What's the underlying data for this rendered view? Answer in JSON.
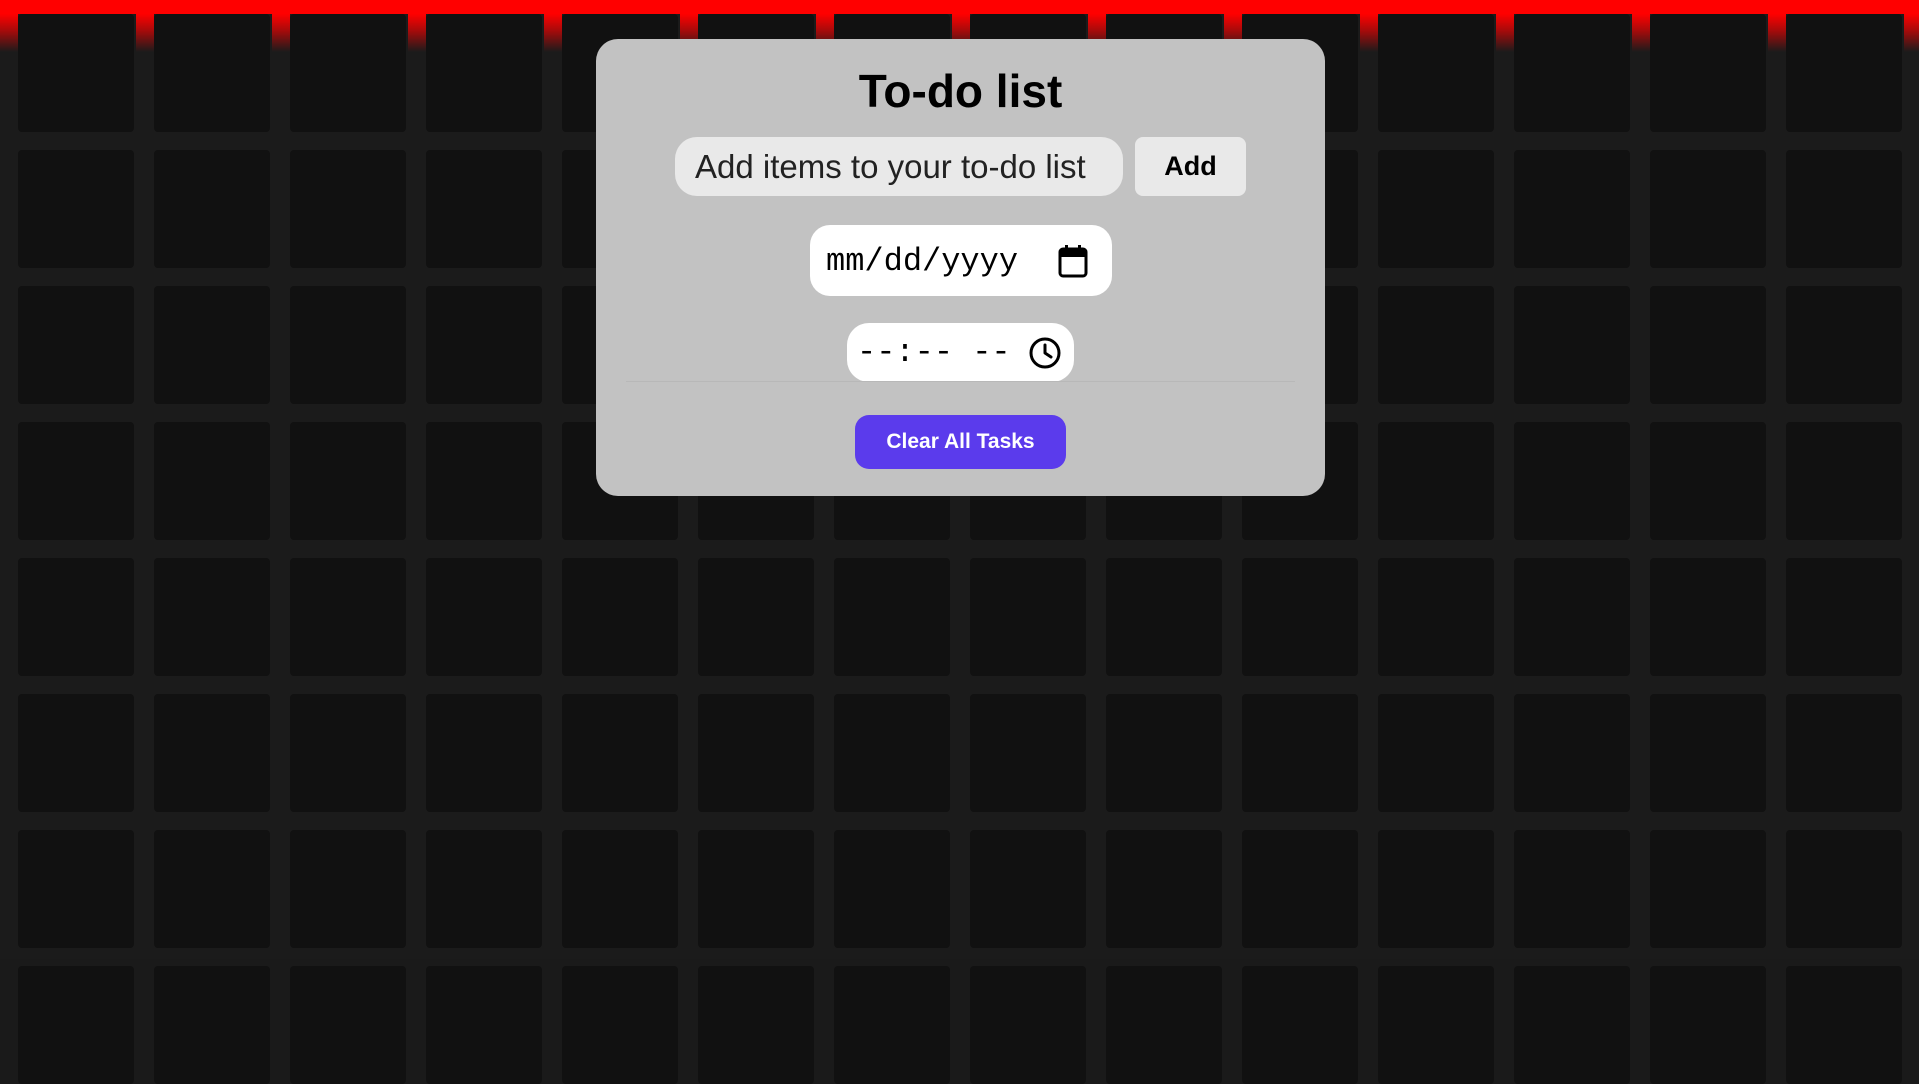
{
  "colors": {
    "background": "#1b1b1b",
    "cell": "#111111",
    "top_bar": "#ff0000",
    "panel": "#c2c2c2",
    "input_bg": "#e9e9e9",
    "accent_button": "#5b3bec"
  },
  "app": {
    "title": "To-do list"
  },
  "task_form": {
    "placeholder": "Add items to your to-do list",
    "add_label": "Add"
  },
  "date_field": {
    "placeholder": "mm/dd/yyyy",
    "icon": "calendar-icon"
  },
  "time_field": {
    "placeholder": "--:-- --",
    "icon": "clock-icon"
  },
  "actions": {
    "clear_label": "Clear All Tasks"
  }
}
